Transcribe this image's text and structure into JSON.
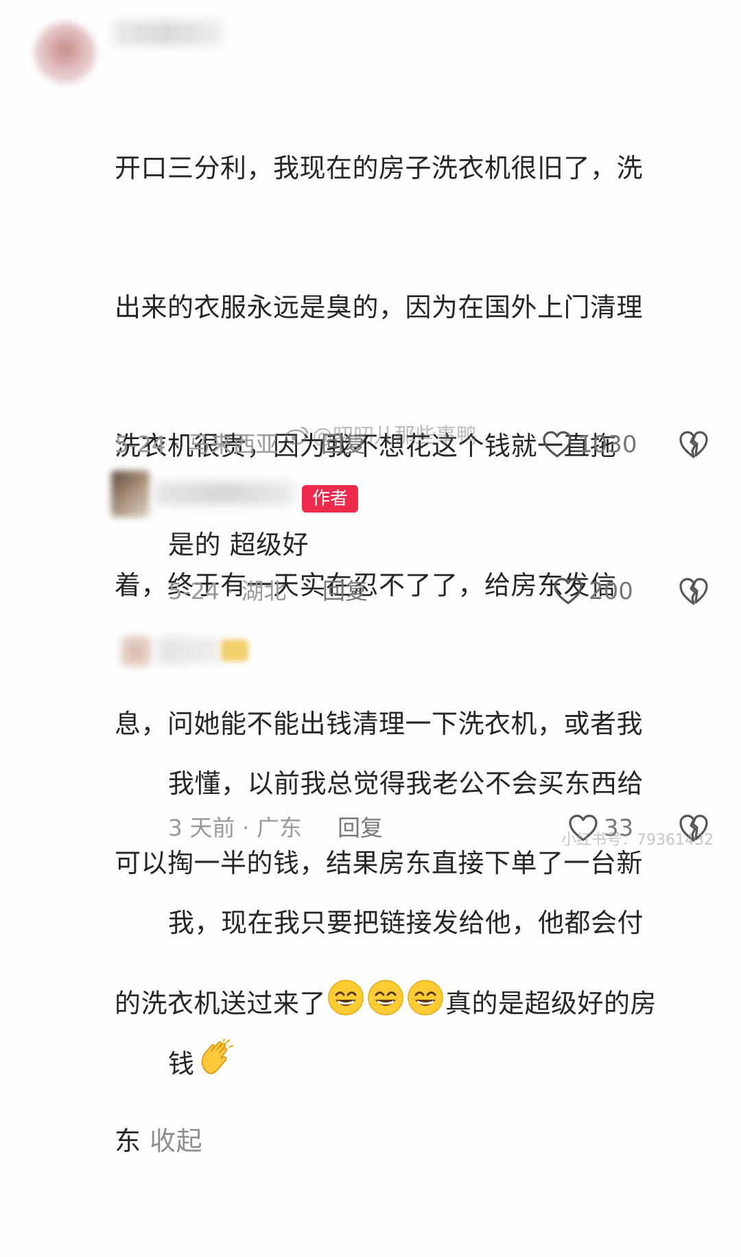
{
  "comments": [
    {
      "lines": [
        "开口三分利，我现在的房子洗衣机很旧了，洗",
        "出来的衣服永远是臭的，因为在国外上门清理",
        "洗衣机很贵，因为我不想花这个钱就一直拖",
        "着，终于有一天实在忍不了了，给房东发信",
        "息，问她能不能出钱清理一下洗衣机，或者我",
        "可以掏一半的钱，结果房东直接下单了一台新"
      ],
      "line7_before": "的洗衣机送过来了",
      "line7_after": "真的是超级好的房",
      "line8": "东",
      "collapse_label": "收起",
      "date_location": "5-24 · 马来西亚",
      "reply_label": "回复",
      "likes": "1030"
    },
    {
      "author_badge": "作者",
      "text": "是的 超级好",
      "date_location": "5-24 · 湖北",
      "reply_label": "回复",
      "likes": "200"
    },
    {
      "lines": [
        "我懂，以前我总觉得我老公不会买东西给",
        "我，现在我只要把链接发给他，他都会付"
      ],
      "line3": "钱",
      "date_location": "3 天前 · 广东",
      "reply_label": "回复",
      "likes": "33"
    }
  ],
  "watermark": "@叨叨儿那些事鸭",
  "corner_watermark": "小红书号：79361432",
  "icons": {
    "like": "heart-outline-icon",
    "dislike": "broken-heart-icon",
    "emoji_grin": "grinning-face-emoji",
    "emoji_clap": "clapping-hands-emoji",
    "weibo": "weibo-logo-icon"
  },
  "colors": {
    "author_badge": "#ee2b4d",
    "text": "#262626",
    "meta": "#9a9a9a"
  }
}
